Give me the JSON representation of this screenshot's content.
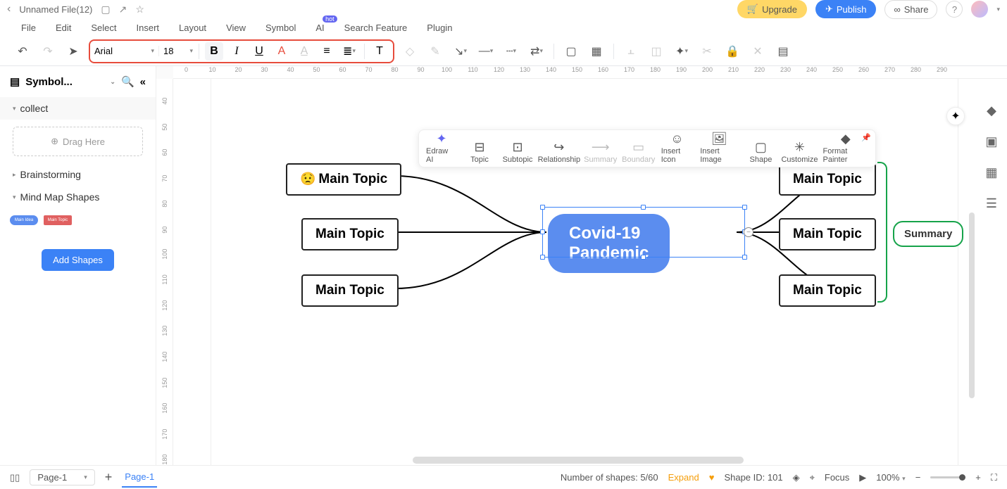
{
  "header": {
    "filename": "Unnamed File(12)",
    "upgrade": "Upgrade",
    "publish": "Publish",
    "share": "Share"
  },
  "menu": {
    "items": [
      "File",
      "Edit",
      "Select",
      "Insert",
      "Layout",
      "View",
      "Symbol",
      "AI",
      "Search Feature",
      "Plugin"
    ],
    "hot_badge": "hot"
  },
  "toolbar": {
    "font_name": "Arial",
    "font_size": "18"
  },
  "sidebar": {
    "title": "Symbol...",
    "collect": "collect",
    "drag_here": "Drag Here",
    "brainstorming": "Brainstorming",
    "mind_map_shapes": "Mind Map Shapes",
    "add_shapes": "Add Shapes"
  },
  "ruler_h": [
    "0",
    "10",
    "20",
    "30",
    "40",
    "50",
    "60",
    "70",
    "80",
    "90",
    "100",
    "110",
    "120",
    "130",
    "140",
    "150",
    "160",
    "170",
    "180",
    "190",
    "200",
    "210",
    "220",
    "230",
    "240",
    "250",
    "260",
    "270",
    "280",
    "290"
  ],
  "ruler_v": [
    "40",
    "50",
    "60",
    "70",
    "80",
    "90",
    "100",
    "110",
    "120",
    "130",
    "140",
    "150",
    "160",
    "170",
    "180"
  ],
  "float_tb": {
    "items": [
      "Edraw AI",
      "Topic",
      "Subtopic",
      "Relationship",
      "Summary",
      "Boundary",
      "Insert Icon",
      "Insert Image",
      "Shape",
      "Customize",
      "Format Painter"
    ]
  },
  "mindmap": {
    "center": "Covid-19 Pandemic",
    "left": [
      "Main Topic",
      "Main Topic",
      "Main Topic"
    ],
    "right": [
      "Main Topic",
      "Main Topic",
      "Main Topic"
    ],
    "summary": "Summary"
  },
  "status": {
    "page_select": "Page-1",
    "page_tab": "Page-1",
    "shapes_label": "Number of shapes: 5/60",
    "expand": "Expand",
    "shape_id": "Shape ID: 101",
    "focus": "Focus",
    "zoom": "100%"
  }
}
